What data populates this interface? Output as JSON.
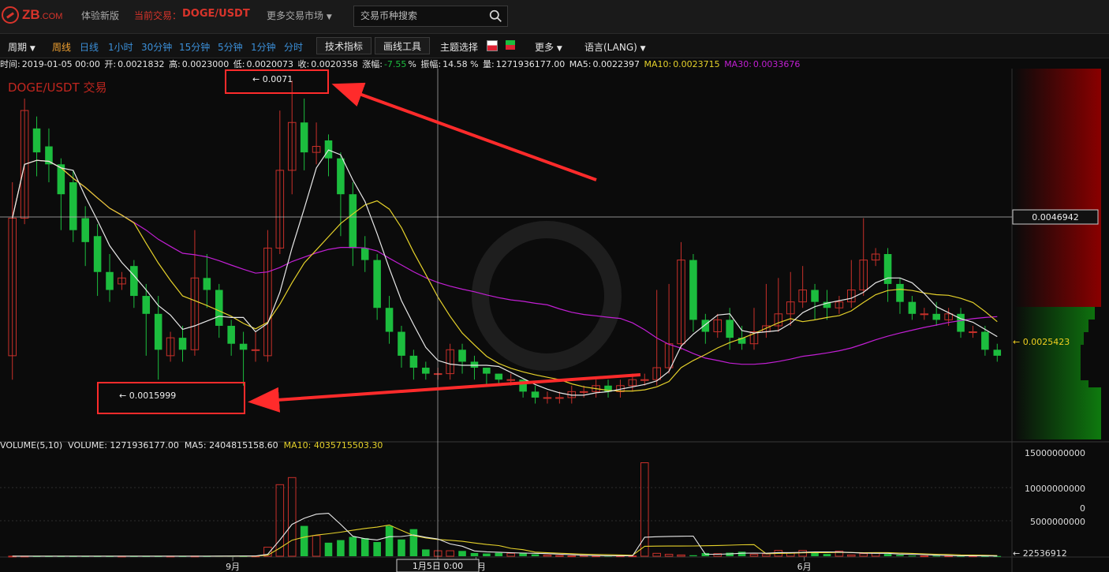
{
  "header": {
    "logo": "ZB.COM",
    "new_version": "体验新版",
    "current_label": "当前交易：",
    "current_pair": "DOGE/USDT",
    "more_markets": "更多交易市场",
    "search_placeholder": "交易币种搜索"
  },
  "toolbar": {
    "period_label": "周期",
    "periods": [
      "周线",
      "日线",
      "1小时",
      "30分钟",
      "15分钟",
      "5分钟",
      "1分钟",
      "分时"
    ],
    "indicators_button": "技术指标",
    "drawing_button": "画线工具",
    "theme_label": "主题选择",
    "more_label": "更多",
    "language_label": "语言(LANG)"
  },
  "info": {
    "time_label": "时间:",
    "time_value": "2019-01-05  00:00",
    "open_label": "开:",
    "open_value": "0.0021832",
    "high_label": "高:",
    "high_value": "0.0023000",
    "low_label": "低:",
    "low_value": "0.0020073",
    "close_label": "收:",
    "close_value": "0.0020358",
    "change_label": "涨幅:",
    "change_value": "-7.55",
    "change_unit": "%",
    "amp_label": "振幅:",
    "amp_value": "14.58 %",
    "vol_label": "量:",
    "vol_value": "1271936177.00",
    "ma5_label": "MA5:",
    "ma5_value": "0.0022397",
    "ma10_label": "MA10:",
    "ma10_value": "0.0023715",
    "ma30_label": "MA30:",
    "ma30_value": "0.0033676"
  },
  "chart_title": "DOGE/USDT 交易",
  "annotations": {
    "high_label": "← 0.0071",
    "low_label": "← 0.0015999"
  },
  "crosshair_price": "0.0046942",
  "last_price": "← 0.0025423",
  "volume_info": {
    "title": "VOLUME(5,10)",
    "vol_label": "VOLUME:",
    "vol_value": "1271936177.00",
    "ma5_label": "MA5:",
    "ma5_value": "2404815158.60",
    "ma10_label": "MA10:",
    "ma10_value": "4035715503.30"
  },
  "volume_axis": [
    "15000000000",
    "10000000000",
    "5000000000",
    "0"
  ],
  "volume_last": "← 22536912",
  "time_axis": {
    "labels": [
      "9月",
      "12月",
      "6月"
    ],
    "crosshair_label": "1月5日  0:00"
  },
  "colors": {
    "up": "#c8302a",
    "down": "#1cbd3e",
    "ma5": "#e8e8e8",
    "ma10": "#e5d12a",
    "ma30": "#c21fd4",
    "annotation": "#ff2b2b",
    "accent": "#d8342b",
    "link": "#3b8fd8",
    "active_period": "#f0a030"
  },
  "chart_data": {
    "type": "candlestick",
    "y_unit": "USDT",
    "candles": [
      [
        0.0025,
        0.0048,
        0.0054,
        0.0021
      ],
      [
        0.0048,
        0.0066,
        0.0068,
        0.0047
      ],
      [
        0.0063,
        0.0059,
        0.0065,
        0.0055
      ],
      [
        0.006,
        0.0057,
        0.0063,
        0.0054
      ],
      [
        0.0057,
        0.0052,
        0.0058,
        0.0046
      ],
      [
        0.0054,
        0.0046,
        0.0056,
        0.0044
      ],
      [
        0.0048,
        0.0044,
        0.005,
        0.004
      ],
      [
        0.0045,
        0.0039,
        0.0047,
        0.0035
      ],
      [
        0.0039,
        0.0036,
        0.0042,
        0.0034
      ],
      [
        0.0037,
        0.0038,
        0.0039,
        0.0036
      ],
      [
        0.004,
        0.0035,
        0.0041,
        0.0033
      ],
      [
        0.0035,
        0.0032,
        0.0037,
        0.0025
      ],
      [
        0.0032,
        0.0026,
        0.0035,
        0.0021
      ],
      [
        0.0025,
        0.0028,
        0.0029,
        0.0024
      ],
      [
        0.0028,
        0.0026,
        0.003,
        0.0024
      ],
      [
        0.0026,
        0.0038,
        0.0046,
        0.0025
      ],
      [
        0.0038,
        0.0036,
        0.0042,
        0.0033
      ],
      [
        0.0036,
        0.003,
        0.0037,
        0.0028
      ],
      [
        0.003,
        0.0027,
        0.0031,
        0.0025
      ],
      [
        0.0027,
        0.0026,
        0.0029,
        0.002
      ],
      [
        0.0026,
        0.0026,
        0.0029,
        0.0024
      ],
      [
        0.0025,
        0.0043,
        0.0046,
        0.0024
      ],
      [
        0.0043,
        0.0056,
        0.0066,
        0.0042
      ],
      [
        0.0056,
        0.0064,
        0.0071,
        0.0052
      ],
      [
        0.0064,
        0.0059,
        0.0068,
        0.0056
      ],
      [
        0.0059,
        0.006,
        0.0064,
        0.0057
      ],
      [
        0.0061,
        0.0058,
        0.0062,
        0.0055
      ],
      [
        0.0058,
        0.0052,
        0.0059,
        0.0045
      ],
      [
        0.0052,
        0.0043,
        0.0054,
        0.004
      ],
      [
        0.0043,
        0.0041,
        0.0045,
        0.0039
      ],
      [
        0.0041,
        0.0033,
        0.0042,
        0.0031
      ],
      [
        0.0033,
        0.0029,
        0.0035,
        0.0027
      ],
      [
        0.0029,
        0.0025,
        0.003,
        0.0023
      ],
      [
        0.0025,
        0.0023,
        0.0026,
        0.0021
      ],
      [
        0.0023,
        0.0022,
        0.0024,
        0.0021
      ],
      [
        0.0022,
        0.0022,
        0.0023,
        0.0021
      ],
      [
        0.0022,
        0.0026,
        0.0027,
        0.0021
      ],
      [
        0.0026,
        0.0024,
        0.0027,
        0.0022
      ],
      [
        0.0024,
        0.0023,
        0.0025,
        0.0021
      ],
      [
        0.0023,
        0.0022,
        0.0023,
        0.002
      ],
      [
        0.0022,
        0.0021,
        0.0022,
        0.002
      ],
      [
        0.0021,
        0.0021,
        0.0022,
        0.002
      ],
      [
        0.0021,
        0.0019,
        0.0021,
        0.0018
      ],
      [
        0.0019,
        0.0018,
        0.002,
        0.0017
      ],
      [
        0.0018,
        0.0018,
        0.0019,
        0.0017
      ],
      [
        0.0018,
        0.0018,
        0.0019,
        0.0017
      ],
      [
        0.0018,
        0.0019,
        0.002,
        0.0017
      ],
      [
        0.0019,
        0.0019,
        0.002,
        0.0018
      ],
      [
        0.0019,
        0.002,
        0.0021,
        0.0018
      ],
      [
        0.002,
        0.0019,
        0.0021,
        0.0018
      ],
      [
        0.0019,
        0.002,
        0.0021,
        0.0018
      ],
      [
        0.002,
        0.0021,
        0.0022,
        0.0019
      ],
      [
        0.0021,
        0.0021,
        0.0022,
        0.002
      ],
      [
        0.0021,
        0.0023,
        0.0036,
        0.002
      ],
      [
        0.0023,
        0.0027,
        0.0037,
        0.0022
      ],
      [
        0.0027,
        0.0041,
        0.0044,
        0.0026
      ],
      [
        0.0041,
        0.0031,
        0.0042,
        0.0029
      ],
      [
        0.0031,
        0.0029,
        0.0032,
        0.0027
      ],
      [
        0.0029,
        0.0031,
        0.0032,
        0.0028
      ],
      [
        0.0031,
        0.0028,
        0.0033,
        0.0026
      ],
      [
        0.0028,
        0.0027,
        0.003,
        0.0026
      ],
      [
        0.0027,
        0.0029,
        0.0033,
        0.0026
      ],
      [
        0.0029,
        0.003,
        0.0037,
        0.0028
      ],
      [
        0.003,
        0.0032,
        0.0038,
        0.0029
      ],
      [
        0.0032,
        0.0034,
        0.0039,
        0.003
      ],
      [
        0.0034,
        0.0036,
        0.004,
        0.0033
      ],
      [
        0.0036,
        0.0034,
        0.0037,
        0.0031
      ],
      [
        0.0034,
        0.0033,
        0.0036,
        0.0031
      ],
      [
        0.0033,
        0.0034,
        0.0035,
        0.0032
      ],
      [
        0.0034,
        0.0036,
        0.0041,
        0.0033
      ],
      [
        0.0036,
        0.0041,
        0.0048,
        0.0035
      ],
      [
        0.0041,
        0.0042,
        0.0043,
        0.004
      ],
      [
        0.0042,
        0.0037,
        0.0043,
        0.0034
      ],
      [
        0.0037,
        0.0034,
        0.0038,
        0.0032
      ],
      [
        0.0034,
        0.0032,
        0.0035,
        0.0031
      ],
      [
        0.0032,
        0.0032,
        0.0033,
        0.0031
      ],
      [
        0.0032,
        0.0031,
        0.0034,
        0.003
      ],
      [
        0.0031,
        0.0032,
        0.0033,
        0.003
      ],
      [
        0.0032,
        0.0029,
        0.0033,
        0.0028
      ],
      [
        0.0029,
        0.0029,
        0.003,
        0.0028
      ],
      [
        0.0029,
        0.0026,
        0.003,
        0.0025
      ],
      [
        0.0026,
        0.0025,
        0.0027,
        0.0024
      ]
    ],
    "volume": [
      0.01,
      0.01,
      0.01,
      0.01,
      0.01,
      0.01,
      0.01,
      0.01,
      0.01,
      0.01,
      0.01,
      0.01,
      0.01,
      0.01,
      0.01,
      0.02,
      0.02,
      0.05,
      0.05,
      0.02,
      0.03,
      1.4,
      11.1,
      12.2,
      4.7,
      3.2,
      2.1,
      2.5,
      3.0,
      2.8,
      2.2,
      4.7,
      2.6,
      4.2,
      1.05,
      0.85,
      0.85,
      0.82,
      0.5,
      0.42,
      0.52,
      0.45,
      0.55,
      0.3,
      0.18,
      0.1,
      0.05,
      0.1,
      0.05,
      0.08,
      0.05,
      0.05,
      14.5,
      0.45,
      0.3,
      0.2,
      0.15,
      0.5,
      0.4,
      0.55,
      0.7,
      0.3,
      0.35,
      0.9,
      0.55,
      0.9,
      0.65,
      0.35,
      0.8,
      0.2,
      0.4,
      0.5,
      0.35,
      0.2,
      0.1,
      0.05,
      0.08,
      0.05,
      0.05,
      0.05,
      0.03,
      0.03
    ],
    "volume_unit": "1e9",
    "ma5": [],
    "ma10": [],
    "ma30": []
  }
}
